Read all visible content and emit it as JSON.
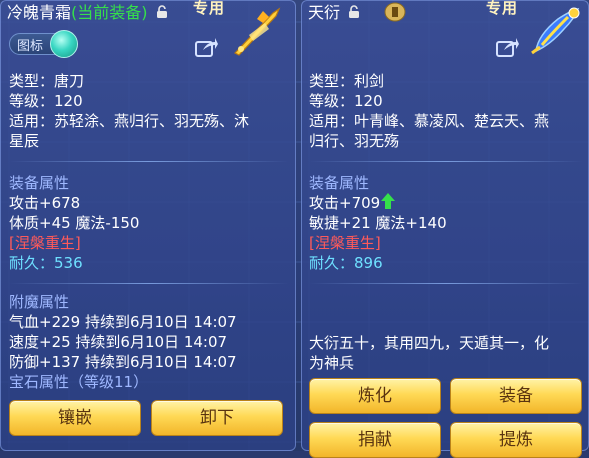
{
  "left_panel": {
    "item_name": "冷魄青霜",
    "equip_status": "(当前装备)",
    "exclusive_label": "专用",
    "toggle_label": "图标",
    "type_line": "类型：唐刀",
    "level_line": "等级：120",
    "suitable_line1": "适用：苏轻涂、燕归行、羽无殇、沐",
    "suitable_line2": "星辰",
    "equip_attr_title": "装备属性",
    "attack_line": "攻击+678",
    "con_magic_line": "体质+45 魔法-150",
    "nirvana_label": "[涅槃重生]",
    "durability_label": "耐久：",
    "durability_value": "536",
    "enchant_title": "附魔属性",
    "enchant_hp": "气血+229 持续到6月10日 14:07",
    "enchant_speed": "速度+25 持续到6月10日 14:07",
    "enchant_defense": "防御+137 持续到6月10日 14:07",
    "gem_title": "宝石属性（等级11）",
    "inlay_button": "镶嵌",
    "unequip_button": "卸下"
  },
  "right_panel": {
    "item_name": "天衍",
    "exclusive_label": "专用",
    "type_line": "类型：利剑",
    "level_line": "等级：120",
    "suitable_line1": "适用：叶青峰、慕凌风、楚云天、燕",
    "suitable_line2": "归行、羽无殇",
    "equip_attr_title": "装备属性",
    "attack_line": "攻击+709",
    "agi_magic_line": "敏捷+21 魔法+140",
    "nirvana_label": "[涅槃重生]",
    "durability_label": "耐久：",
    "durability_value": "896",
    "description_line1": "大衍五十，其用四九，天遁其一，化",
    "description_line2": "为神兵",
    "refine_button": "炼化",
    "equip_button": "装备",
    "donate_button": "捐献",
    "extract_button": "提炼"
  },
  "colors": {
    "equip_status": "#35e04a",
    "section_title": "#9fb8ff",
    "nirvana": "#ff5a5a",
    "durability": "#6ee0ff",
    "button_gold": "#ffd955",
    "button_text": "#5a3410",
    "increase_arrow": "#35e04a"
  },
  "icons": [
    "lock-icon",
    "share-icon",
    "weapon-blade-icon",
    "weapon-sword-icon",
    "increase-arrow-icon",
    "icon-toggle"
  ]
}
